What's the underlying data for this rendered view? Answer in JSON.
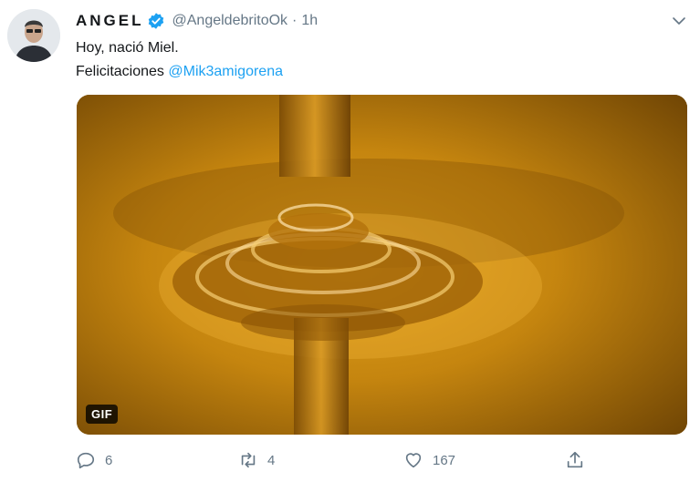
{
  "tweet": {
    "display_name": "ANGEL",
    "handle": "@AngeldebritoOk",
    "separator": "·",
    "time": "1h",
    "text_line1": "Hoy, nació Miel.",
    "text_line2_prefix": "Felicitaciones ",
    "mention": "@Mik3amigorena",
    "media_badge": "GIF"
  },
  "actions": {
    "reply_count": "6",
    "retweet_count": "4",
    "like_count": "167"
  },
  "colors": {
    "accent": "#1da1f2",
    "secondary_text": "#657786",
    "primary_text": "#14171a",
    "honey": "#b97c0d"
  },
  "icons": [
    "avatar",
    "verified-badge-icon",
    "chevron-down-icon",
    "reply-icon",
    "retweet-icon",
    "like-icon",
    "share-icon"
  ]
}
